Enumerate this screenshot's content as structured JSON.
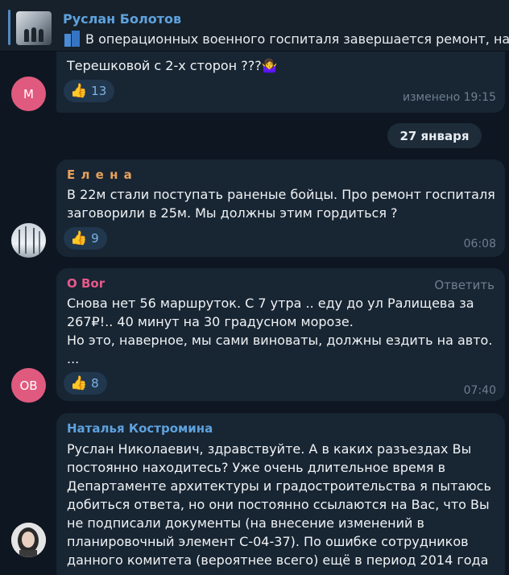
{
  "pinned": {
    "name": "Руслан Болотов",
    "text": "В операционных военного госпиталя завершается ремонт, нач"
  },
  "messages": [
    {
      "avatar_letter": "M",
      "avatar_color": "#e05a7f",
      "lines": [
        "Терешковой с 2-х сторон ???🤷‍♀️"
      ],
      "reaction_count": "13",
      "time": "изменено 19:15"
    },
    {
      "sender": "Е л е н а",
      "sender_color": "#e8a25c",
      "lines": [
        "В 22м стали поступать раненые бойцы. Про ремонт госпиталя",
        "заговорили в 25м. Мы должны этим гордиться ?"
      ],
      "reaction_count": "9",
      "time": "06:08"
    },
    {
      "sender": "O Bor",
      "sender_color": "#e8598a",
      "reply_label": "Ответить",
      "avatar_letter": "OB",
      "avatar_color": "#e05a7f",
      "lines": [
        "Снова нет 56 маршруток.  С 7 утра .. еду до ул Ралищева за",
        "267₽!..  40 минут на 30 градусном морозе.",
        "Но это, наверное, мы сами виноваты, должны ездить на авто.",
        "..."
      ],
      "reaction_count": "8",
      "time": "07:40"
    },
    {
      "sender": "Наталья Костромина",
      "sender_color": "#5ea2dd",
      "lines": [
        "Руслан Николаевич, здравствуйте.  А в каких разъездах Вы",
        "постоянно находитесь? Уже очень длительное время в",
        "Департаменте архитектуры и градостроительства я пытаюсь",
        "добиться ответа, но они постоянно ссылаются на Вас, что Вы",
        "не подписали документы (на внесение изменений в",
        "планировочный элемент С-04-37). По ошибке сотрудников",
        "данного комитета (вероятнее всего) ещё в период 2014 года"
      ]
    }
  ],
  "date_separator": "27 января",
  "colors": {
    "background": "#0e1621",
    "bubble": "#182533",
    "accent": "#5ea2dd"
  },
  "icons": {
    "reaction": "thumbs-up-icon",
    "pinned_emoji": "office-building-icon"
  }
}
